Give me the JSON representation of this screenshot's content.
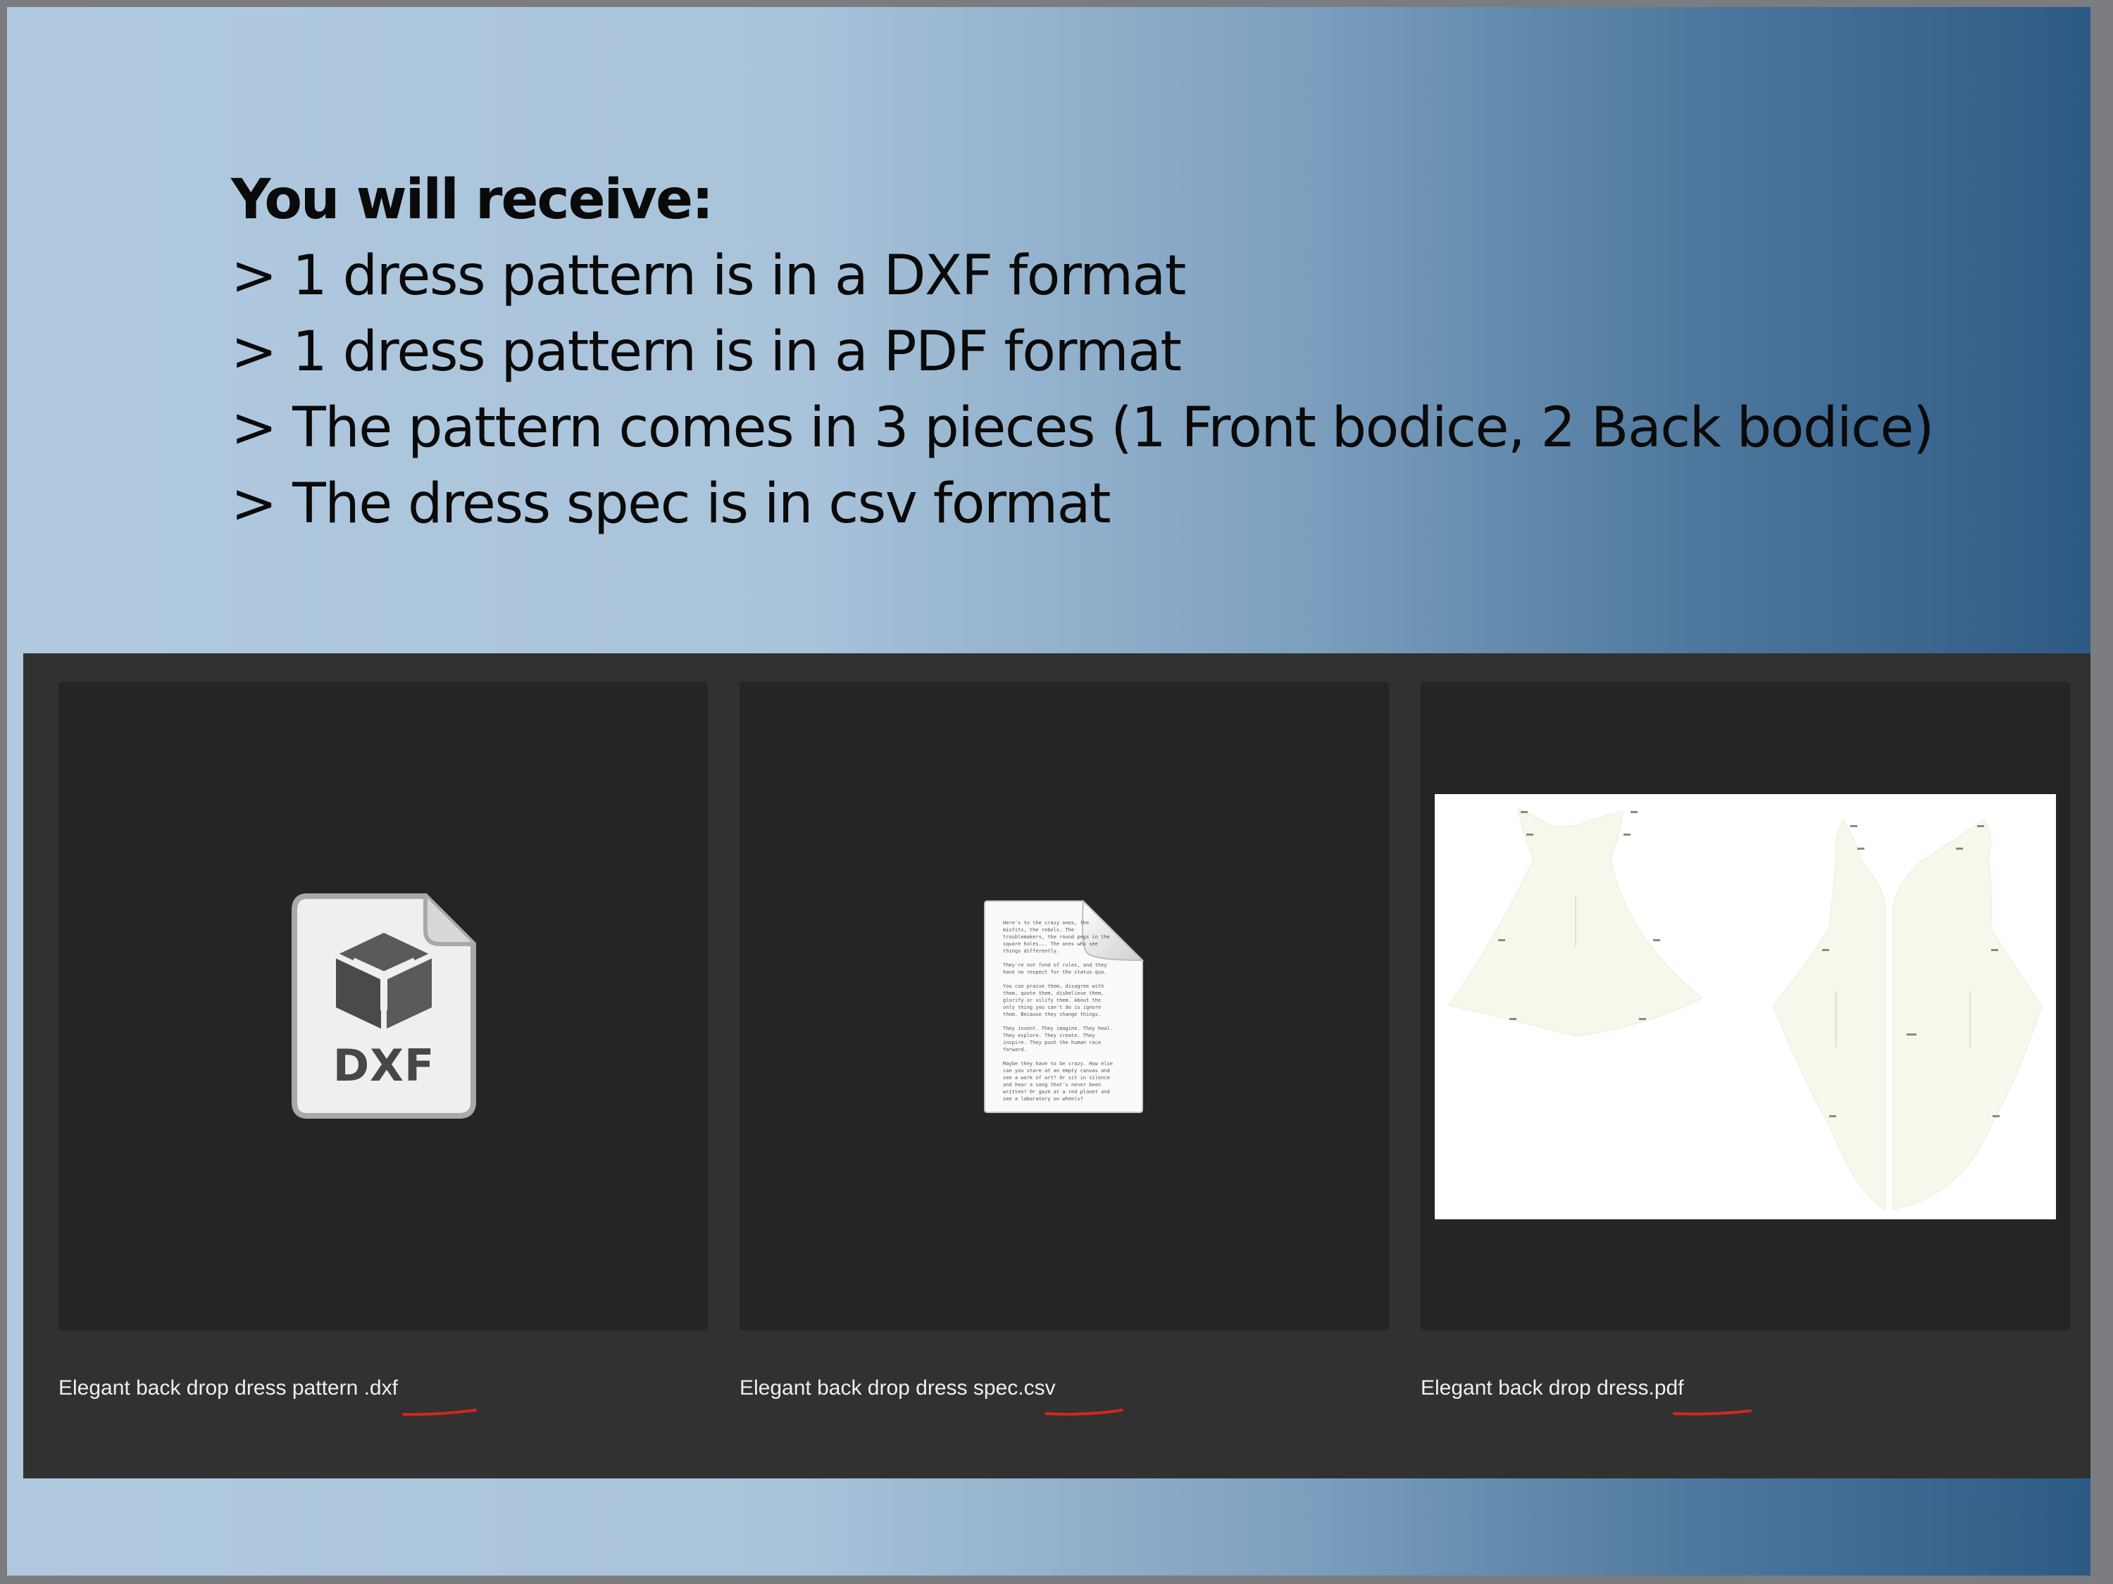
{
  "intro": {
    "heading": "You will receive:",
    "lines": [
      "> 1 dress pattern is in a DXF format",
      "> 1 dress pattern is in a PDF format",
      "> The pattern comes in 3 pieces (1 Front bodice, 2 Back bodice)",
      "> The dress spec is in csv format"
    ]
  },
  "files": [
    {
      "name": "Elegant back drop dress pattern .dxf",
      "icon": "dxf-file-icon",
      "badge": "DXF"
    },
    {
      "name": "Elegant back drop dress spec.csv",
      "icon": "text-document-icon"
    },
    {
      "name": "Elegant back drop dress.pdf",
      "icon": "pdf-preview"
    }
  ],
  "doc_preview_text": "Here's to the crazy ones, the misfits, the rebels. The troublemakers, the round pegs in the square holes... The ones who see things differently.\n\nThey're not fond of rules, and they have no respect for the status quo.\n\nYou can praise them, disagree with them, quote them, disbelieve them, glorify or vilify them. About the only thing you can't do is ignore them. Because they change things.\n\nThey invent. They imagine. They heal. They explore. They create. They inspire. They push the human race forward.\n\nMaybe they have to be crazy. How else can you stare at an empty canvas and see a work of art? Or sit in silence and hear a song that's never been written? Or gaze at a red planet and see a laboratory on wheels?",
  "colors": {
    "underline": "#d0271d",
    "panel": "#313131",
    "tile": "#252525",
    "pattern_fill": "#f7f7ec"
  }
}
